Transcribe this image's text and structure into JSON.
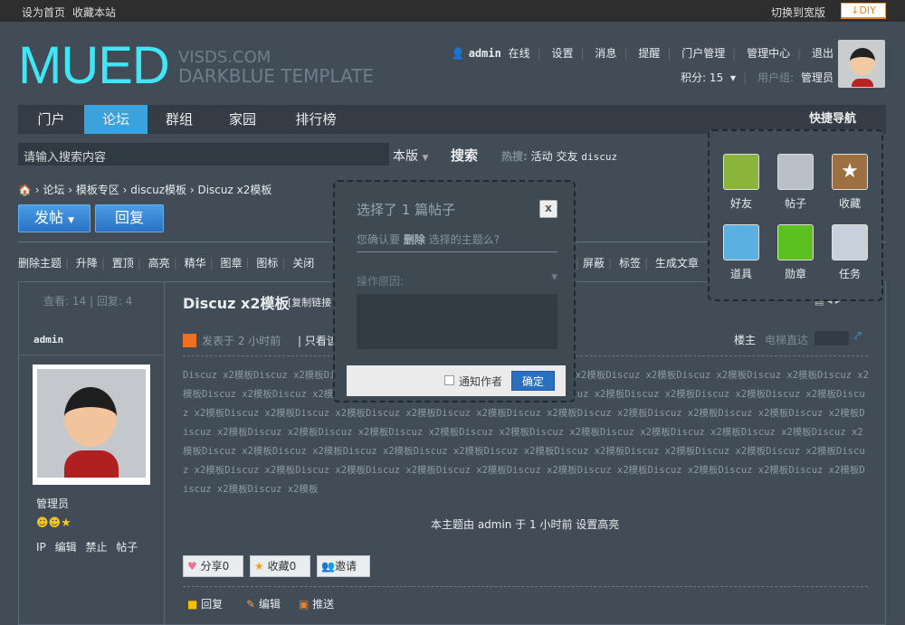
{
  "topbar": {
    "set_home": "设为首页",
    "bookmark": "收藏本站",
    "switch_wide": "切换到宽版",
    "diy": "DIY"
  },
  "logo": {
    "main": "MUED",
    "sub1": "VISDS.COM",
    "sub2": "DARKBLUE TEMPLATE"
  },
  "user": {
    "name": "admin",
    "status": "在线",
    "links": [
      "设置",
      "消息",
      "提醒",
      "门户管理",
      "管理中心",
      "退出"
    ],
    "points_label": "积分: 15",
    "group_label": "用户组:",
    "group": "管理员"
  },
  "nav": {
    "items": [
      "门户",
      "论坛",
      "群组",
      "家园",
      "排行榜"
    ],
    "active": 1,
    "quick_nav": "快捷导航"
  },
  "search": {
    "placeholder": "请输入搜索内容",
    "scope": "本版",
    "button": "搜索",
    "hot_label": "热搜:",
    "hot": [
      "活动",
      "交友",
      "discuz"
    ]
  },
  "breadcrumb": [
    "论坛",
    "模板专区",
    "discuz模板",
    "Discuz x2模板"
  ],
  "actions": {
    "post": "发帖",
    "reply": "回复"
  },
  "modbar": {
    "left": [
      "删除主题",
      "升降",
      "置顶",
      "高亮",
      "精华",
      "图章",
      "图标",
      "关闭"
    ],
    "right": [
      "屏蔽",
      "标签",
      "生成文章"
    ]
  },
  "thread": {
    "views": "查看: 14",
    "replies": "回复: 4",
    "title": "Discuz x2模板",
    "copy_link": "[复制链接",
    "author": "admin",
    "posted": "发表于 2 小时前",
    "only_author": "只看该",
    "floor": "楼主",
    "jump": "电梯直达",
    "group": "管理员",
    "user_links": [
      "IP",
      "编辑",
      "禁止",
      "帖子"
    ],
    "content": "Discuz x2模板Discuz x2模板Discuz x2模板Discuz x2模板Discuz x2模板Discuz x2模板Discuz x2模板Discuz x2模板Discuz x2模板Discuz x2模板Discuz x2模板Discuz x2模板Discuz x2模板Discuz x2模板Discuz x2模板Discuz x2模板Discuz x2模板Discuz x2模板Discuz x2模板Discuz x2模板Discuz x2模板Discuz x2模板Discuz x2模板Discuz x2模板Discuz x2模板Discuz x2模板Discuz x2模板Discuz x2模板Discuz x2模板Discuz x2模板Discuz x2模板Discuz x2模板Discuz x2模板Discuz x2模板Discuz x2模板Discuz x2模板Discuz x2模板Discuz x2模板Discuz x2模板Discuz x2模板Discuz x2模板Discuz x2模板Discuz x2模板Discuz x2模板Discuz x2模板Discuz x2模板Discuz x2模板Discuz x2模板Discuz x2模板Discuz x2模板Discuz x2模板Discuz x2模板Discuz x2模板Discuz x2模板Discuz x2模板Discuz x2模板Discuz x2模板Discuz x2模板Discuz x2模板Discuz x2模板",
    "mod_note": "本主题由 admin 于 1 小时前 设置高亮",
    "share": "分享0",
    "fav": "收藏0",
    "invite": "邀请",
    "reply": "回复",
    "edit": "编辑",
    "push": "推送"
  },
  "dialog": {
    "title": "选择了 1 篇帖子",
    "confirm_pre": "您确认要",
    "confirm_action": "删除",
    "confirm_post": "选择的主题么?",
    "reason_label": "操作原因:",
    "notify": "通知作者",
    "ok": "确定",
    "close": "x"
  },
  "quick": {
    "items": [
      "好友",
      "帖子",
      "收藏",
      "道具",
      "勋章",
      "任务"
    ],
    "colors": [
      "#8ab43a",
      "#b8c0c8",
      "#9c7040",
      "#5ab0e0",
      "#5cc020",
      "#c8d0dc"
    ]
  }
}
